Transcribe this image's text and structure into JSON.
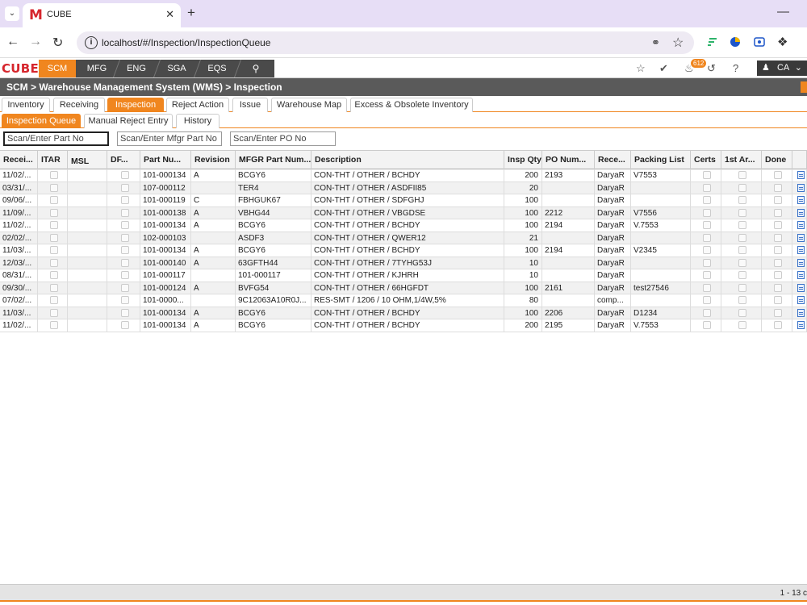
{
  "browser": {
    "tab_title": "CUBE",
    "tab_favicon": "M",
    "url": "localhost/#/Inspection/InspectionQueue"
  },
  "app": {
    "logo": "CUBE",
    "modules": [
      "SCM",
      "MFG",
      "ENG",
      "SGA",
      "EQS"
    ],
    "active_module": "SCM",
    "notification_count": "612",
    "help_label": "?",
    "user_initials": "CA",
    "accent_color": "#f0861f"
  },
  "breadcrumb": {
    "text": "SCM > Warehouse Management System (WMS) > Inspection"
  },
  "main_tabs": [
    "Inventory",
    "Receiving",
    "Inspection",
    "Reject Action",
    "Issue",
    "Warehouse Map",
    "Excess & Obsolete Inventory"
  ],
  "active_main_tab": "Inspection",
  "sub_tabs": [
    "Inspection Queue",
    "Manual Reject Entry",
    "History"
  ],
  "active_sub_tab": "Inspection Queue",
  "filters": {
    "part_no_placeholder": "Scan/Enter Part No",
    "mfgr_part_no_placeholder": "Scan/Enter Mfgr Part No",
    "po_no_placeholder": "Scan/Enter PO No"
  },
  "grid": {
    "columns": [
      "Recei...",
      "ITAR",
      "MSL",
      "DF...",
      "Part Nu...",
      "Revision",
      "MFGR Part Num...",
      "Description",
      "Insp Qty",
      "PO Num...",
      "Rece...",
      "Packing List",
      "Certs",
      "1st Ar...",
      "Done",
      ""
    ],
    "rows": [
      {
        "recv": "11/02/...",
        "msl": "",
        "part": "101-000134",
        "rev": "A",
        "mfgr": "BCGY6",
        "desc": "CON-THT / OTHER / BCHDY",
        "qty": "200",
        "po": "2193",
        "rec": "DaryaR",
        "pack": "V7553"
      },
      {
        "recv": "03/31/...",
        "msl": "",
        "part": "107-000112",
        "rev": "",
        "mfgr": "TER4",
        "desc": "CON-THT / OTHER / ASDFII85",
        "qty": "20",
        "po": "",
        "rec": "DaryaR",
        "pack": ""
      },
      {
        "recv": "09/06/...",
        "msl": "",
        "part": "101-000119",
        "rev": "C",
        "mfgr": "FBHGUK67",
        "desc": "CON-THT / OTHER / SDFGHJ",
        "qty": "100",
        "po": "",
        "rec": "DaryaR",
        "pack": ""
      },
      {
        "recv": "11/09/...",
        "msl": "",
        "part": "101-000138",
        "rev": "A",
        "mfgr": "VBHG44",
        "desc": "CON-THT / OTHER / VBGDSE",
        "qty": "100",
        "po": "2212",
        "rec": "DaryaR",
        "pack": "V7556"
      },
      {
        "recv": "11/02/...",
        "msl": "",
        "part": "101-000134",
        "rev": "A",
        "mfgr": "BCGY6",
        "desc": "CON-THT / OTHER / BCHDY",
        "qty": "100",
        "po": "2194",
        "rec": "DaryaR",
        "pack": "V.7553"
      },
      {
        "recv": "02/02/...",
        "msl": "",
        "part": "102-000103",
        "rev": "",
        "mfgr": "ASDF3",
        "desc": "CON-THT / OTHER / QWER12",
        "qty": "21",
        "po": "",
        "rec": "DaryaR",
        "pack": ""
      },
      {
        "recv": "11/03/...",
        "msl": "",
        "part": "101-000134",
        "rev": "A",
        "mfgr": "BCGY6",
        "desc": "CON-THT / OTHER / BCHDY",
        "qty": "100",
        "po": "2194",
        "rec": "DaryaR",
        "pack": "V2345"
      },
      {
        "recv": "12/03/...",
        "msl": "",
        "part": "101-000140",
        "rev": "A",
        "mfgr": "63GFTH44",
        "desc": "CON-THT / OTHER / 7TYHG53J",
        "qty": "10",
        "po": "",
        "rec": "DaryaR",
        "pack": ""
      },
      {
        "recv": "08/31/...",
        "msl": "",
        "part": "101-000117",
        "rev": "",
        "mfgr": "101-000117",
        "desc": "CON-THT / OTHER / KJHRH",
        "qty": "10",
        "po": "",
        "rec": "DaryaR",
        "pack": ""
      },
      {
        "recv": "09/30/...",
        "msl": "",
        "part": "101-000124",
        "rev": "A",
        "mfgr": "BVFG54",
        "desc": "CON-THT / OTHER / 66HGFDT",
        "qty": "100",
        "po": "2161",
        "rec": "DaryaR",
        "pack": "test27546"
      },
      {
        "recv": "07/02/...",
        "msl": "",
        "part": "101-0000...",
        "rev": "",
        "mfgr": "9C12063A10R0J...",
        "desc": "RES-SMT / 1206 / 10 OHM,1/4W,5%",
        "qty": "80",
        "po": "",
        "rec": "comp...",
        "pack": ""
      },
      {
        "recv": "11/03/...",
        "msl": "",
        "part": "101-000134",
        "rev": "A",
        "mfgr": "BCGY6",
        "desc": "CON-THT / OTHER / BCHDY",
        "qty": "100",
        "po": "2206",
        "rec": "DaryaR",
        "pack": "D1234"
      },
      {
        "recv": "11/02/...",
        "msl": "",
        "part": "101-000134",
        "rev": "A",
        "mfgr": "BCGY6",
        "desc": "CON-THT / OTHER / BCHDY",
        "qty": "200",
        "po": "2195",
        "rec": "DaryaR",
        "pack": "V.7553"
      }
    ]
  },
  "footer": {
    "pager_text": "1 - 13 c"
  }
}
